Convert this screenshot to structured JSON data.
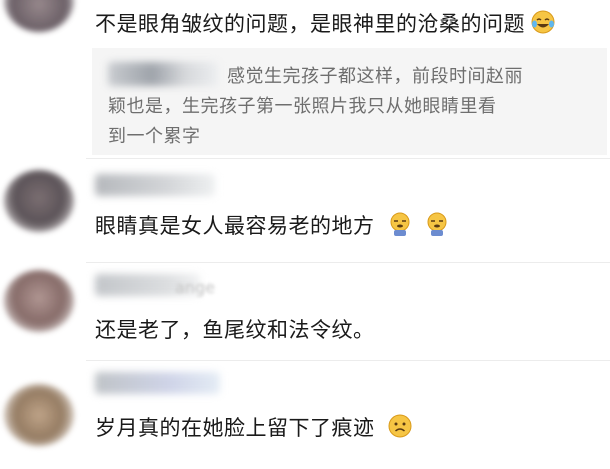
{
  "comments": [
    {
      "text": "不是眼角皱纹的问题，是眼神里的沧桑的问题",
      "emoji": "laughing-crying-emoji",
      "reply": {
        "line1": "感觉生完孩子都这样，前段时间赵丽",
        "line2": "颖也是，生完孩子第一张照片我只从她眼睛里看",
        "line3": "到一个累字"
      }
    },
    {
      "text": "眼睛真是女人最容易老的地方",
      "emoji": [
        "sleepy-emoji",
        "sleepy-emoji"
      ]
    },
    {
      "nickname_fragment": "ange",
      "text": "还是老了，鱼尾纹和法令纹。"
    },
    {
      "text": "岁月真的在她脸上留下了痕迹",
      "emoji": "sad-emoji"
    }
  ],
  "colors": {
    "text": "#1a1a1a",
    "reply_text": "#6e6e6e",
    "reply_bg": "#f5f5f5",
    "divider": "#ececec"
  }
}
